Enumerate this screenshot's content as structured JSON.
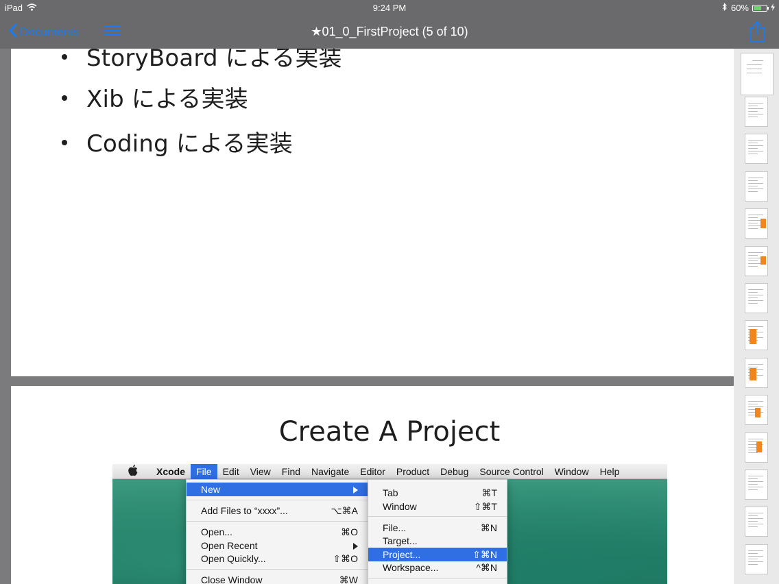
{
  "status_bar": {
    "device": "iPad",
    "time": "9:24 PM",
    "battery_percent": "60%",
    "battery_level": 0.6
  },
  "nav_bar": {
    "back_label": "Documents",
    "title": "★01_0_FirstProject (5 of 10)"
  },
  "page1": {
    "bullets": [
      "StoryBoard による実装",
      "Xib による実装",
      "Coding による実装"
    ]
  },
  "page2": {
    "title": "Create A Project",
    "menubar": [
      "Xcode",
      "File",
      "Edit",
      "View",
      "Find",
      "Navigate",
      "Editor",
      "Product",
      "Debug",
      "Source Control",
      "Window",
      "Help"
    ],
    "file_menu": [
      {
        "label": "New",
        "shortcut": ""
      },
      {
        "label": "Add Files to “xxxx”...",
        "shortcut": "⌥⌘A"
      },
      {
        "label": "Open...",
        "shortcut": "⌘O"
      },
      {
        "label": "Open Recent",
        "shortcut": ""
      },
      {
        "label": "Open Quickly...",
        "shortcut": "⇧⌘O"
      },
      {
        "label": "Close Window",
        "shortcut": "⌘W"
      }
    ],
    "new_menu": [
      {
        "label": "Tab",
        "shortcut": "⌘T"
      },
      {
        "label": "Window",
        "shortcut": "⇧⌘T"
      },
      {
        "label": "File...",
        "shortcut": "⌘N"
      },
      {
        "label": "Target...",
        "shortcut": ""
      },
      {
        "label": "Project...",
        "shortcut": "⇧⌘N"
      },
      {
        "label": "Workspace...",
        "shortcut": "^⌘N"
      }
    ]
  },
  "thumbnails": {
    "count": 14,
    "current_index": 0
  },
  "colors": {
    "accent": "#1a7cf0",
    "bar": "#6a6a6c",
    "menu_highlight": "#2f6fe3",
    "thumb_orange": "#f0861d"
  }
}
